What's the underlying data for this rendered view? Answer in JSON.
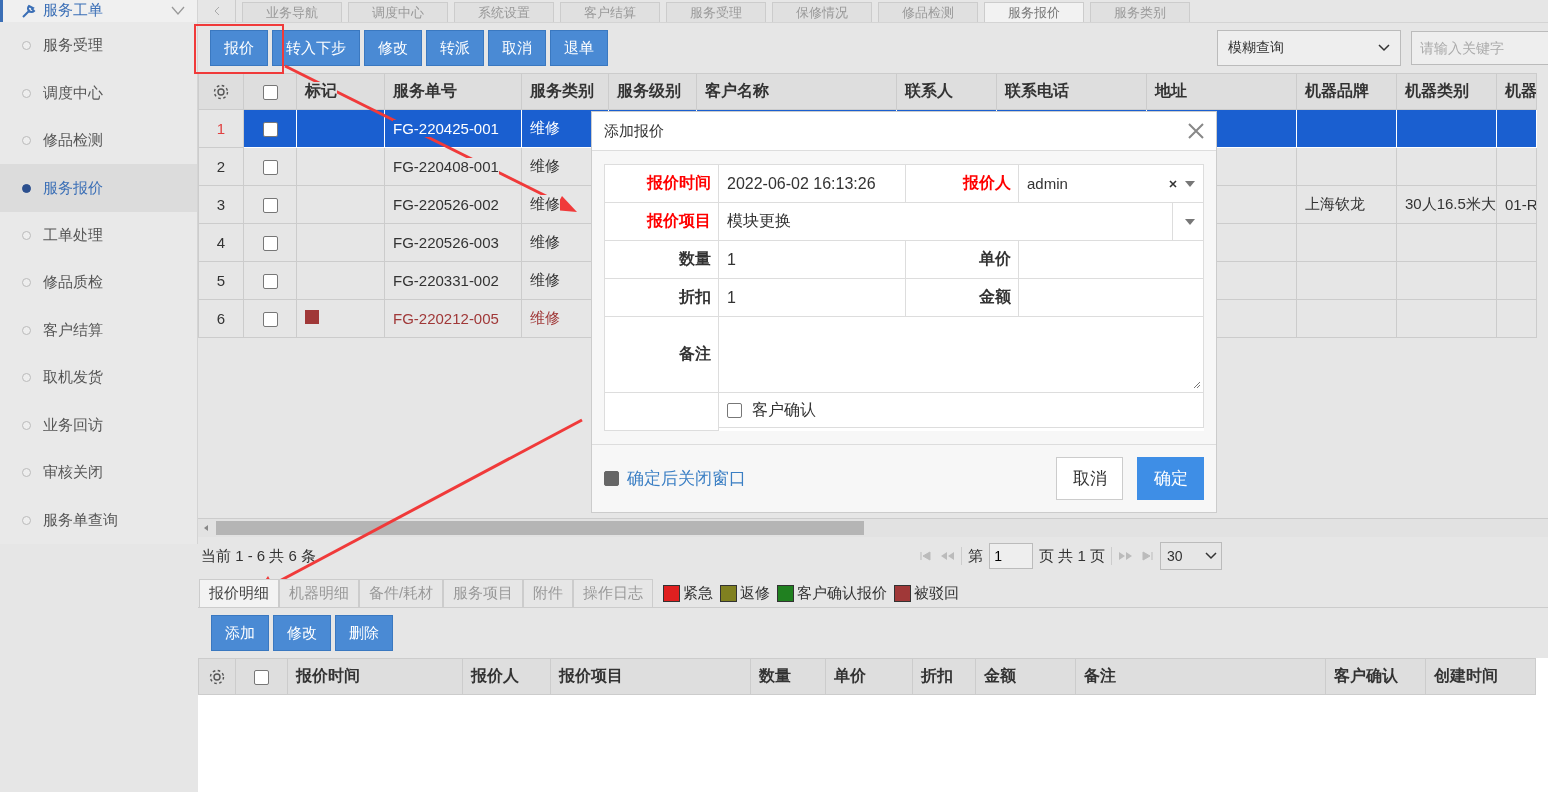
{
  "sidebar": {
    "title": "服务工单",
    "items": [
      {
        "label": "服务受理",
        "selected": false
      },
      {
        "label": "调度中心",
        "selected": false
      },
      {
        "label": "修品检测",
        "selected": false
      },
      {
        "label": "服务报价",
        "selected": true
      },
      {
        "label": "工单处理",
        "selected": false
      },
      {
        "label": "修品质检",
        "selected": false
      },
      {
        "label": "客户结算",
        "selected": false
      },
      {
        "label": "取机发货",
        "selected": false
      },
      {
        "label": "业务回访",
        "selected": false
      },
      {
        "label": "审核关闭",
        "selected": false
      },
      {
        "label": "服务单查询",
        "selected": false
      }
    ]
  },
  "tabs": [
    {
      "label": "业务导航",
      "selected": false
    },
    {
      "label": "调度中心",
      "selected": false
    },
    {
      "label": "系统设置",
      "selected": false
    },
    {
      "label": "客户结算",
      "selected": false
    },
    {
      "label": "服务受理",
      "selected": false
    },
    {
      "label": "保修情况",
      "selected": false
    },
    {
      "label": "修品检测",
      "selected": false
    },
    {
      "label": "服务报价",
      "selected": true
    },
    {
      "label": "服务类别",
      "selected": false
    }
  ],
  "toolbar": [
    "报价",
    "转入下步",
    "修改",
    "转派",
    "取消",
    "退单"
  ],
  "search": {
    "mode": "模糊查询",
    "placeholder": "请输入关键字"
  },
  "grid": {
    "header_checked": false,
    "columns": [
      "标记",
      "服务单号",
      "服务类别",
      "服务级别",
      "客户名称",
      "联系人",
      "联系电话",
      "地址",
      "机器品牌",
      "机器类别",
      "机器"
    ],
    "rows": [
      {
        "number": "1",
        "checked": false,
        "selected": true,
        "order_no": "FG-220425-001",
        "category": "维修"
      },
      {
        "number": "2",
        "checked": false,
        "selected": false,
        "order_no": "FG-220408-001",
        "category": "维修"
      },
      {
        "number": "3",
        "checked": false,
        "selected": false,
        "order_no": "FG-220526-002",
        "category": "维修",
        "brand": "上海钦龙",
        "machine_type": "30人16.5米大",
        "column_13": "01-R"
      },
      {
        "number": "4",
        "checked": false,
        "selected": false,
        "order_no": "FG-220526-003",
        "category": "维修"
      },
      {
        "number": "5",
        "checked": false,
        "selected": false,
        "order_no": "FG-220331-002",
        "category": "维修"
      },
      {
        "number": "6",
        "checked": false,
        "selected": false,
        "color": "#a03838",
        "order_no": "FG-220212-005",
        "category": "维修"
      }
    ]
  },
  "pager": {
    "summary": "当前 1 - 6 共 6 条",
    "page_prefix": "第",
    "page": "1",
    "page_suffix": "页 共 1 页",
    "page_size": "30"
  },
  "detail_tabs": [
    {
      "label": "报价明细",
      "selected": true
    },
    {
      "label": "机器明细",
      "selected": false
    },
    {
      "label": "备件/耗材",
      "selected": false
    },
    {
      "label": "服务项目",
      "selected": false
    },
    {
      "label": "附件",
      "selected": false
    },
    {
      "label": "操作日志",
      "selected": false
    }
  ],
  "legend": [
    {
      "label": "紧急",
      "color": "#e02020"
    },
    {
      "label": "返修",
      "color": "#808020"
    },
    {
      "label": "客户确认报价",
      "color": "#208020"
    },
    {
      "label": "被驳回",
      "color": "#a03838"
    }
  ],
  "detail_toolbar": [
    "添加",
    "修改",
    "删除"
  ],
  "detail_grid": {
    "header_checked": false,
    "columns": [
      "报价时间",
      "报价人",
      "报价项目",
      "数量",
      "单价",
      "折扣",
      "金额",
      "备注",
      "客户确认",
      "创建时间"
    ]
  },
  "dialog": {
    "title": "添加报价",
    "fields": [
      {
        "kind": "text",
        "label": "报价时间",
        "required": true,
        "value": "2022-06-02 16:13:26"
      },
      {
        "kind": "combo",
        "label": "报价人",
        "required": true,
        "value": "admin"
      },
      {
        "kind": "select",
        "label": "报价项目",
        "required": true,
        "value": "模块更换"
      },
      {
        "kind": "text",
        "label": "数量",
        "required": false,
        "value": "1"
      },
      {
        "kind": "text",
        "label": "单价",
        "required": false
      },
      {
        "kind": "text",
        "label": "折扣",
        "required": false,
        "value": "1"
      },
      {
        "kind": "text",
        "label": "金额",
        "required": false
      },
      {
        "kind": "textarea",
        "label": "备注",
        "required": false
      },
      {
        "kind": "checkbox",
        "text": "客户确认",
        "checked": false
      }
    ],
    "close_after": {
      "label": "确定后关闭窗口",
      "checked": true
    },
    "buttons": [
      {
        "label": "取消",
        "kind": "secondary"
      },
      {
        "label": "确定",
        "kind": "primary"
      }
    ]
  }
}
